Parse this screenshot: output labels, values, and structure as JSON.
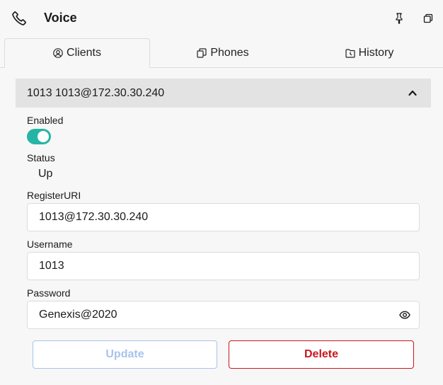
{
  "header": {
    "title": "Voice",
    "icons": {
      "app": "phone-icon",
      "pin": "pin-icon",
      "popout": "popout-icon"
    }
  },
  "tabs": [
    {
      "label": "Clients",
      "icon": "user-circle-icon",
      "active": true
    },
    {
      "label": "Phones",
      "icon": "phones-icon",
      "active": false
    },
    {
      "label": "History",
      "icon": "history-icon",
      "active": false
    }
  ],
  "client": {
    "header_title": "1013 1013@172.30.30.240",
    "expanded": true,
    "enabled_label": "Enabled",
    "enabled": true,
    "status_label": "Status",
    "status_value": "Up",
    "register_uri_label": "RegisterURI",
    "register_uri_value": "1013@172.30.30.240",
    "username_label": "Username",
    "username_value": "1013",
    "password_label": "Password",
    "password_value": "Genexis@2020"
  },
  "actions": {
    "update_label": "Update",
    "update_enabled": false,
    "delete_label": "Delete"
  },
  "colors": {
    "toggle_on": "#26b5a4",
    "delete": "#c8161c",
    "update_disabled": "#a9c3ec",
    "accordion_bg": "#e3e3e3",
    "background": "#f7f7f7"
  }
}
